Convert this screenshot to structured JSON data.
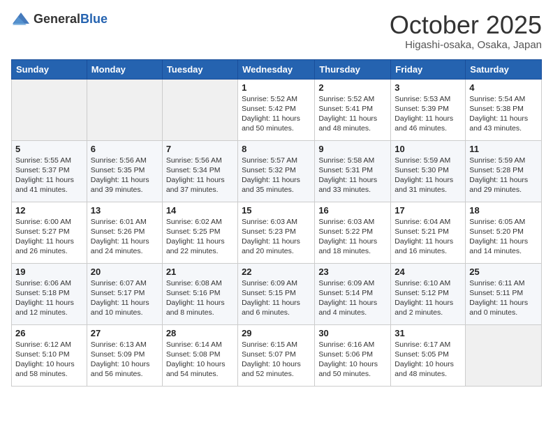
{
  "header": {
    "logo_general": "General",
    "logo_blue": "Blue",
    "month_title": "October 2025",
    "location": "Higashi-osaka, Osaka, Japan"
  },
  "weekdays": [
    "Sunday",
    "Monday",
    "Tuesday",
    "Wednesday",
    "Thursday",
    "Friday",
    "Saturday"
  ],
  "weeks": [
    [
      {
        "day": "",
        "info": ""
      },
      {
        "day": "",
        "info": ""
      },
      {
        "day": "",
        "info": ""
      },
      {
        "day": "1",
        "info": "Sunrise: 5:52 AM\nSunset: 5:42 PM\nDaylight: 11 hours\nand 50 minutes."
      },
      {
        "day": "2",
        "info": "Sunrise: 5:52 AM\nSunset: 5:41 PM\nDaylight: 11 hours\nand 48 minutes."
      },
      {
        "day": "3",
        "info": "Sunrise: 5:53 AM\nSunset: 5:39 PM\nDaylight: 11 hours\nand 46 minutes."
      },
      {
        "day": "4",
        "info": "Sunrise: 5:54 AM\nSunset: 5:38 PM\nDaylight: 11 hours\nand 43 minutes."
      }
    ],
    [
      {
        "day": "5",
        "info": "Sunrise: 5:55 AM\nSunset: 5:37 PM\nDaylight: 11 hours\nand 41 minutes."
      },
      {
        "day": "6",
        "info": "Sunrise: 5:56 AM\nSunset: 5:35 PM\nDaylight: 11 hours\nand 39 minutes."
      },
      {
        "day": "7",
        "info": "Sunrise: 5:56 AM\nSunset: 5:34 PM\nDaylight: 11 hours\nand 37 minutes."
      },
      {
        "day": "8",
        "info": "Sunrise: 5:57 AM\nSunset: 5:32 PM\nDaylight: 11 hours\nand 35 minutes."
      },
      {
        "day": "9",
        "info": "Sunrise: 5:58 AM\nSunset: 5:31 PM\nDaylight: 11 hours\nand 33 minutes."
      },
      {
        "day": "10",
        "info": "Sunrise: 5:59 AM\nSunset: 5:30 PM\nDaylight: 11 hours\nand 31 minutes."
      },
      {
        "day": "11",
        "info": "Sunrise: 5:59 AM\nSunset: 5:28 PM\nDaylight: 11 hours\nand 29 minutes."
      }
    ],
    [
      {
        "day": "12",
        "info": "Sunrise: 6:00 AM\nSunset: 5:27 PM\nDaylight: 11 hours\nand 26 minutes."
      },
      {
        "day": "13",
        "info": "Sunrise: 6:01 AM\nSunset: 5:26 PM\nDaylight: 11 hours\nand 24 minutes."
      },
      {
        "day": "14",
        "info": "Sunrise: 6:02 AM\nSunset: 5:25 PM\nDaylight: 11 hours\nand 22 minutes."
      },
      {
        "day": "15",
        "info": "Sunrise: 6:03 AM\nSunset: 5:23 PM\nDaylight: 11 hours\nand 20 minutes."
      },
      {
        "day": "16",
        "info": "Sunrise: 6:03 AM\nSunset: 5:22 PM\nDaylight: 11 hours\nand 18 minutes."
      },
      {
        "day": "17",
        "info": "Sunrise: 6:04 AM\nSunset: 5:21 PM\nDaylight: 11 hours\nand 16 minutes."
      },
      {
        "day": "18",
        "info": "Sunrise: 6:05 AM\nSunset: 5:20 PM\nDaylight: 11 hours\nand 14 minutes."
      }
    ],
    [
      {
        "day": "19",
        "info": "Sunrise: 6:06 AM\nSunset: 5:18 PM\nDaylight: 11 hours\nand 12 minutes."
      },
      {
        "day": "20",
        "info": "Sunrise: 6:07 AM\nSunset: 5:17 PM\nDaylight: 11 hours\nand 10 minutes."
      },
      {
        "day": "21",
        "info": "Sunrise: 6:08 AM\nSunset: 5:16 PM\nDaylight: 11 hours\nand 8 minutes."
      },
      {
        "day": "22",
        "info": "Sunrise: 6:09 AM\nSunset: 5:15 PM\nDaylight: 11 hours\nand 6 minutes."
      },
      {
        "day": "23",
        "info": "Sunrise: 6:09 AM\nSunset: 5:14 PM\nDaylight: 11 hours\nand 4 minutes."
      },
      {
        "day": "24",
        "info": "Sunrise: 6:10 AM\nSunset: 5:12 PM\nDaylight: 11 hours\nand 2 minutes."
      },
      {
        "day": "25",
        "info": "Sunrise: 6:11 AM\nSunset: 5:11 PM\nDaylight: 11 hours\nand 0 minutes."
      }
    ],
    [
      {
        "day": "26",
        "info": "Sunrise: 6:12 AM\nSunset: 5:10 PM\nDaylight: 10 hours\nand 58 minutes."
      },
      {
        "day": "27",
        "info": "Sunrise: 6:13 AM\nSunset: 5:09 PM\nDaylight: 10 hours\nand 56 minutes."
      },
      {
        "day": "28",
        "info": "Sunrise: 6:14 AM\nSunset: 5:08 PM\nDaylight: 10 hours\nand 54 minutes."
      },
      {
        "day": "29",
        "info": "Sunrise: 6:15 AM\nSunset: 5:07 PM\nDaylight: 10 hours\nand 52 minutes."
      },
      {
        "day": "30",
        "info": "Sunrise: 6:16 AM\nSunset: 5:06 PM\nDaylight: 10 hours\nand 50 minutes."
      },
      {
        "day": "31",
        "info": "Sunrise: 6:17 AM\nSunset: 5:05 PM\nDaylight: 10 hours\nand 48 minutes."
      },
      {
        "day": "",
        "info": ""
      }
    ]
  ]
}
